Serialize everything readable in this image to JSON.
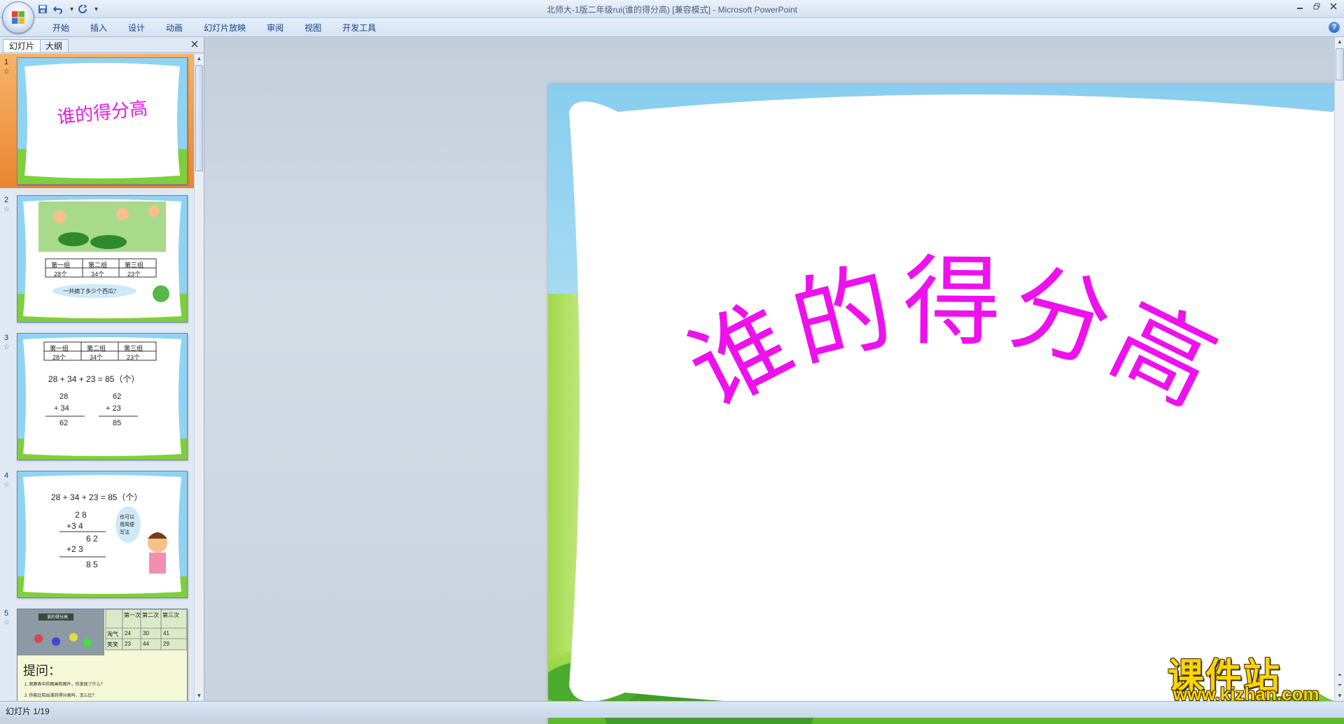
{
  "window": {
    "title": "北师大-1版二年级rui(谁的得分高) [兼容模式] - Microsoft PowerPoint"
  },
  "ribbon": {
    "tabs": [
      "开始",
      "插入",
      "设计",
      "动画",
      "幻灯片放映",
      "审阅",
      "视图",
      "开发工具"
    ]
  },
  "left_pane": {
    "tabs": [
      "幻灯片",
      "大纲"
    ],
    "thumbnails": [
      {
        "number": "1",
        "title": "谁的得分高"
      },
      {
        "number": "2",
        "table_headers": [
          "第一组",
          "第二组",
          "第三组"
        ],
        "table_values": [
          "28个",
          "34个",
          "23个"
        ],
        "question": "一共摘了多少个西瓜？"
      },
      {
        "number": "3",
        "table_headers": [
          "第一组",
          "第二组",
          "第三组"
        ],
        "table_values": [
          "28个",
          "34个",
          "23个"
        ],
        "equation": "28 + 34 + 23 = 85（个）",
        "calc_a": [
          "28",
          "+ 34",
          "62"
        ],
        "calc_b": [
          "62",
          "+ 23",
          "85"
        ]
      },
      {
        "number": "4",
        "equation": "28 + 34 + 23 = 85（个）",
        "calc": [
          "2 8",
          "+3 4",
          "6 2",
          "+2 3",
          "8 5"
        ],
        "bubble": "也可以用简便写法"
      },
      {
        "number": "5",
        "photo_label": "谁的得分高",
        "table_headers": [
          "",
          "第一次",
          "第二次",
          "第三次"
        ],
        "row1": [
          "淘气",
          "24",
          "30",
          "41"
        ],
        "row2": [
          "笑笑",
          "23",
          "44",
          "29"
        ],
        "question_title": "提问：",
        "q1": "1. 观察表中的图画和图片，你发现了什么？",
        "q2": "2. 你能比较出谁的得分高吗，怎么比？"
      }
    ]
  },
  "slide": {
    "title": "谁的得分高"
  },
  "status": {
    "slide_indicator": "幻灯片 1/19"
  },
  "watermark": {
    "big": "课件站",
    "small": "www.kjzhan.com"
  },
  "colors": {
    "title_magenta": "#ee11ee",
    "selection_orange": "#e8862e",
    "ribbon_text": "#15428b"
  }
}
